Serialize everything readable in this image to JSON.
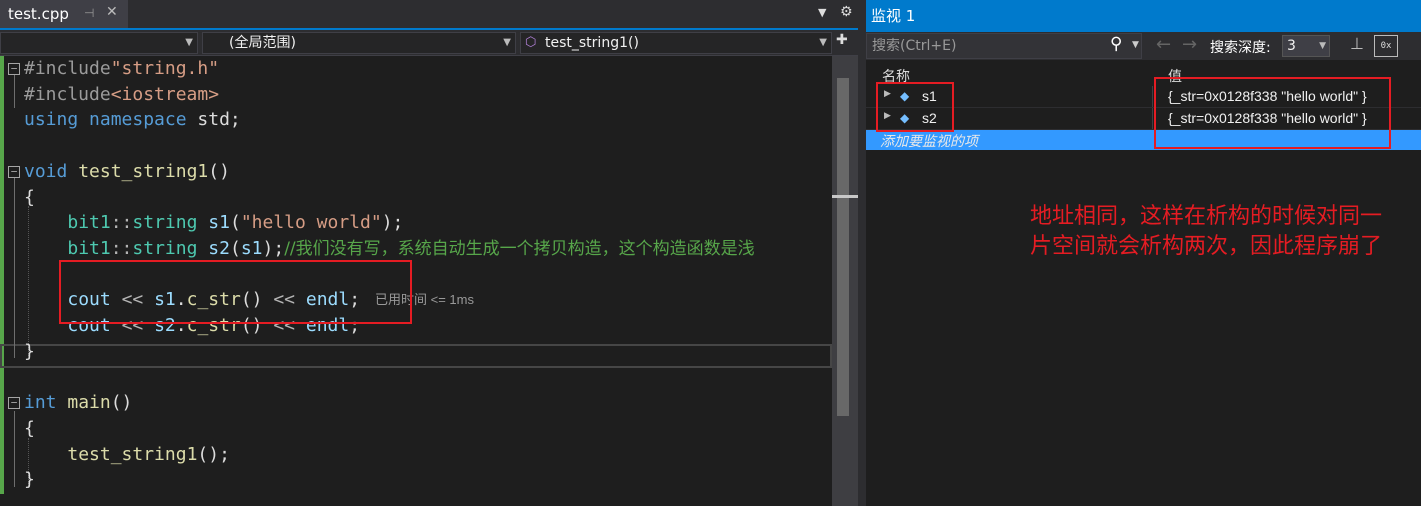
{
  "editor": {
    "tab": {
      "title": "test.cpp",
      "pin": "⊣",
      "close": "✕"
    },
    "nav": {
      "project": "",
      "scope": "(全局范围)",
      "member": "test_string1()"
    },
    "perf_tip": "已用时间 <= 1ms",
    "code_lines": [
      {
        "parts": [
          [
            "pp",
            "#include"
          ],
          [
            "str",
            "\"string.h\""
          ]
        ]
      },
      {
        "parts": [
          [
            "pp",
            "#include"
          ],
          [
            "str",
            "<iostream>"
          ]
        ]
      },
      {
        "parts": [
          [
            "kw",
            "using"
          ],
          [
            "",
            " "
          ],
          [
            "kw",
            "namespace"
          ],
          [
            "",
            " std;"
          ]
        ]
      },
      {
        "parts": []
      },
      {
        "parts": [
          [
            "kw",
            "void"
          ],
          [
            "",
            " "
          ],
          [
            "fn",
            "test_string1"
          ],
          [
            "",
            "()"
          ]
        ]
      },
      {
        "parts": [
          [
            "",
            "{"
          ]
        ]
      },
      {
        "parts": [
          [
            "",
            "    "
          ],
          [
            "ns",
            "bit1"
          ],
          [
            "op",
            "::"
          ],
          [
            "ns",
            "string"
          ],
          [
            "",
            " "
          ],
          [
            "var",
            "s1"
          ],
          [
            "",
            "("
          ],
          [
            "str",
            "\"hello world\""
          ],
          [
            "",
            ");"
          ]
        ]
      },
      {
        "parts": [
          [
            "",
            "    "
          ],
          [
            "ns",
            "bit1"
          ],
          [
            "op",
            "::"
          ],
          [
            "ns",
            "string"
          ],
          [
            "",
            " "
          ],
          [
            "var",
            "s2"
          ],
          [
            "",
            "("
          ],
          [
            "var",
            "s1"
          ],
          [
            "",
            ");"
          ],
          [
            "cm",
            "//我们没有写，系统自动生成一个拷贝构造，这个构造函数是浅"
          ]
        ]
      },
      {
        "parts": []
      },
      {
        "parts": [
          [
            "",
            "    "
          ],
          [
            "var",
            "cout"
          ],
          [
            "",
            " "
          ],
          [
            "op",
            "<<"
          ],
          [
            "",
            " "
          ],
          [
            "var",
            "s1"
          ],
          [
            "",
            "."
          ],
          [
            "fn",
            "c_str"
          ],
          [
            "",
            "() "
          ],
          [
            "op",
            "<<"
          ],
          [
            "",
            " "
          ],
          [
            "var",
            "endl"
          ],
          [
            "",
            ";"
          ]
        ]
      },
      {
        "parts": [
          [
            "",
            "    "
          ],
          [
            "var",
            "cout"
          ],
          [
            "",
            " "
          ],
          [
            "op",
            "<<"
          ],
          [
            "",
            " "
          ],
          [
            "var",
            "s2"
          ],
          [
            "",
            "."
          ],
          [
            "fn",
            "c_str"
          ],
          [
            "",
            "() "
          ],
          [
            "op",
            "<<"
          ],
          [
            "",
            " "
          ],
          [
            "var",
            "endl"
          ],
          [
            "",
            ";"
          ]
        ]
      },
      {
        "parts": [
          [
            "",
            "}"
          ]
        ]
      },
      {
        "parts": []
      },
      {
        "parts": [
          [
            "kw",
            "int"
          ],
          [
            "",
            " "
          ],
          [
            "fn",
            "main"
          ],
          [
            "",
            "()"
          ]
        ]
      },
      {
        "parts": [
          [
            "",
            "{"
          ]
        ]
      },
      {
        "parts": [
          [
            "",
            "    "
          ],
          [
            "fn",
            "test_string1"
          ],
          [
            "",
            "();"
          ]
        ]
      },
      {
        "parts": [
          [
            "",
            "}"
          ]
        ]
      }
    ]
  },
  "watch": {
    "title": "监视 1",
    "search_placeholder": "搜索(Ctrl+E)",
    "depth_label": "搜索深度:",
    "depth_value": "3",
    "col_name": "名称",
    "col_value": "值",
    "rows": [
      {
        "name": "s1",
        "value": "{_str=0x0128f338 \"hello world\" }"
      },
      {
        "name": "s2",
        "value": "{_str=0x0128f338 \"hello world\" }"
      }
    ],
    "add_hint": "添加要监视的项"
  },
  "annotation": {
    "line1": "地址相同，这样在析构的时候对同一",
    "line2": "片空间就会析构两次，因此程序崩了"
  },
  "colors": {
    "accent": "#007acc",
    "highlight": "#e51c23",
    "selection": "#3399ff"
  }
}
